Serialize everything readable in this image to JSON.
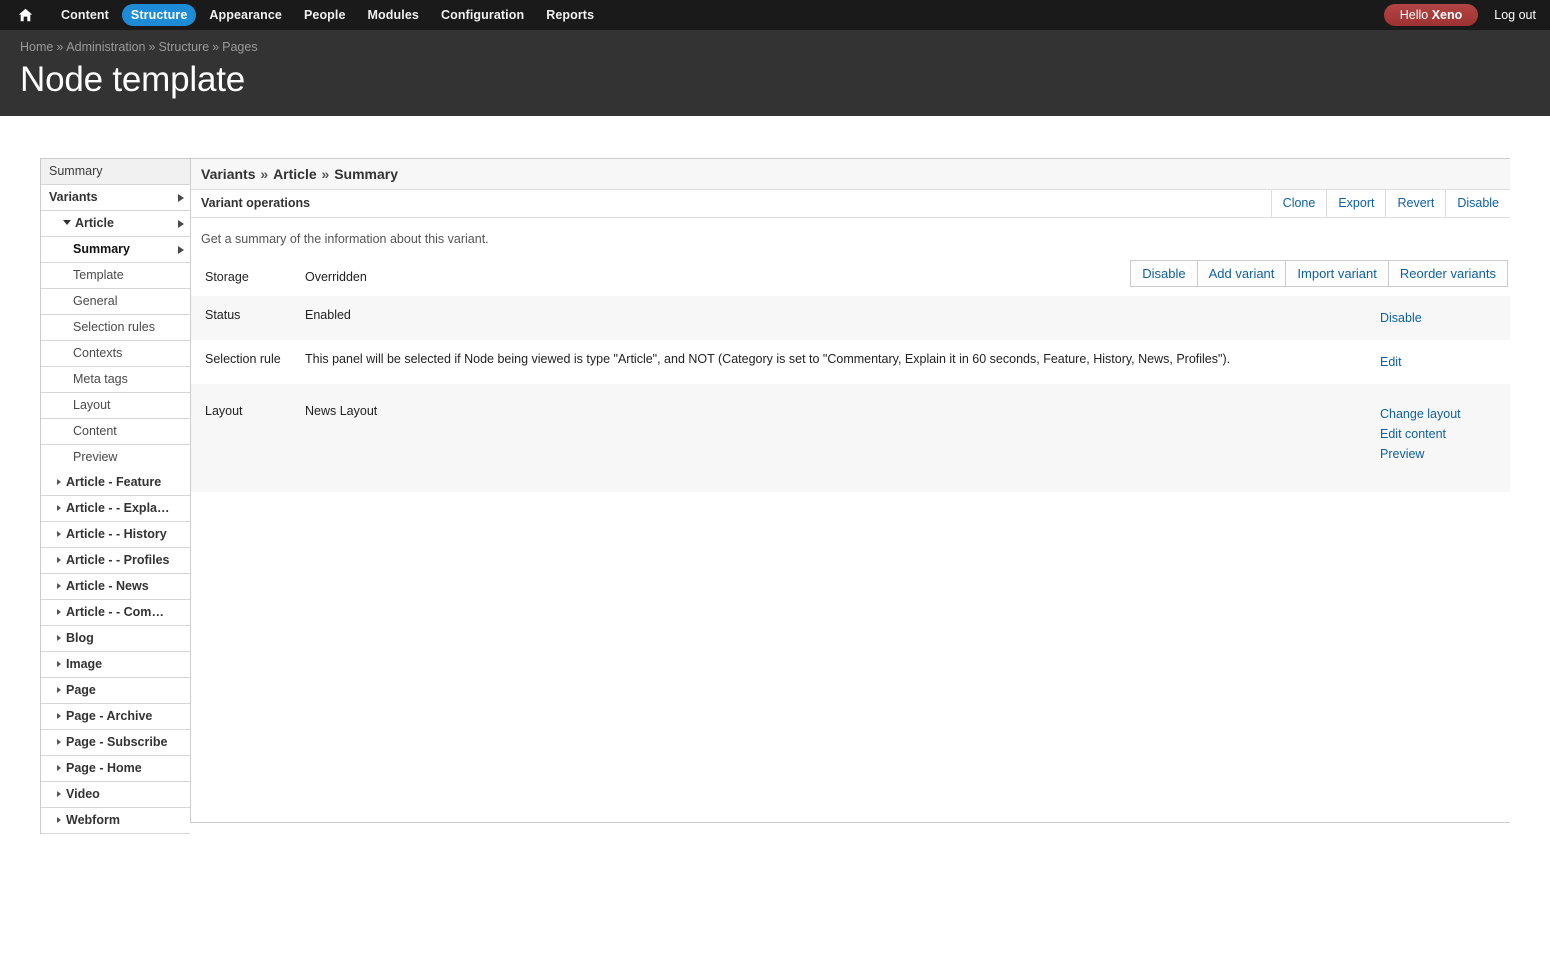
{
  "toolbar": {
    "home_icon": "home-icon",
    "items": [
      {
        "label": "Content",
        "active": false
      },
      {
        "label": "Structure",
        "active": true
      },
      {
        "label": "Appearance",
        "active": false
      },
      {
        "label": "People",
        "active": false
      },
      {
        "label": "Modules",
        "active": false
      },
      {
        "label": "Configuration",
        "active": false
      },
      {
        "label": "Reports",
        "active": false
      }
    ],
    "greeting_prefix": "Hello ",
    "greeting_user": "Xeno",
    "logout_label": "Log out",
    "active_color": "#1e8bd6",
    "badge_color": "#a33a3a"
  },
  "header": {
    "breadcrumb": [
      "Home",
      "Administration",
      "Structure",
      "Pages"
    ],
    "breadcrumb_separator": "»",
    "title": "Node template"
  },
  "local_actions": [
    {
      "label": "Disable"
    },
    {
      "label": "Add variant"
    },
    {
      "label": "Import variant"
    },
    {
      "label": "Reorder variants"
    }
  ],
  "sidebar": {
    "summary_label": "Summary",
    "variants_label": "Variants",
    "article_label": "Article",
    "article_children": [
      {
        "label": "Summary",
        "selected": true
      },
      {
        "label": "Template",
        "selected": false
      },
      {
        "label": "General",
        "selected": false
      },
      {
        "label": "Selection rules",
        "selected": false
      },
      {
        "label": "Contexts",
        "selected": false
      },
      {
        "label": "Meta tags",
        "selected": false
      },
      {
        "label": "Layout",
        "selected": false
      },
      {
        "label": "Content",
        "selected": false
      },
      {
        "label": "Preview",
        "selected": false
      }
    ],
    "groups": [
      {
        "label": "Article - Feature"
      },
      {
        "label": "Article - - Explain it..."
      },
      {
        "label": "Article - - History"
      },
      {
        "label": "Article - - Profiles"
      },
      {
        "label": "Article - News"
      },
      {
        "label": "Article - - Commentary"
      },
      {
        "label": "Blog"
      },
      {
        "label": "Image"
      },
      {
        "label": "Page"
      },
      {
        "label": "Page - Archive"
      },
      {
        "label": "Page - Subscribe"
      },
      {
        "label": "Page - Home"
      },
      {
        "label": "Video"
      },
      {
        "label": "Webform"
      }
    ]
  },
  "panel": {
    "title_parts": [
      "Variants",
      "Article",
      "Summary"
    ],
    "title_separator": "»",
    "operations_title": "Variant operations",
    "operations": [
      {
        "label": "Clone"
      },
      {
        "label": "Export"
      },
      {
        "label": "Revert"
      },
      {
        "label": "Disable"
      }
    ],
    "description": "Get a summary of the information about this variant.",
    "rows": [
      {
        "label": "Storage",
        "value": "Overridden",
        "actions": []
      },
      {
        "label": "Status",
        "value": "Enabled",
        "actions": [
          "Disable"
        ]
      },
      {
        "label": "Selection rule",
        "value": "This panel will be selected if Node being viewed is type \"Article\", and NOT (Category is set to \"Commentary, Explain it in 60 seconds, Feature, History, News, Profiles\").",
        "actions": [
          "Edit"
        ]
      },
      {
        "label": "Layout",
        "value": "News Layout",
        "actions": [
          "Change layout",
          "Edit content",
          "Preview"
        ]
      }
    ]
  }
}
